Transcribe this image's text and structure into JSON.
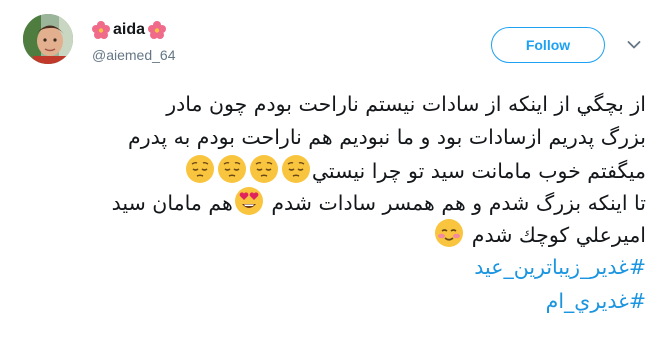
{
  "user": {
    "display_name": "aida",
    "handle": "@aiemed_64",
    "avatar": "avatar-photo",
    "name_emoji": "hibiscus-icon"
  },
  "actions": {
    "follow_label": "Follow",
    "caret_icon": "chevron-down-icon"
  },
  "colors": {
    "accent": "#1da1f2",
    "hashtag": "#1b95e0",
    "text": "#14171a",
    "muted": "#657786"
  },
  "tweet": {
    "line1": "از بچگي از اينكه از سادات نيستم ناراحت بودم چون مادر",
    "line2": "بزرگ پدريم ازسادات بود و ما نبوديم هم ناراحت بودم به پدرم",
    "line3": "ميگفتم  خوب مامانت سيد تو چرا نيستي",
    "line3_emoji": "pensive-face-icon",
    "line4a": "تا اينكه بزرگ شدم و هم همسر سادات شدم",
    "line4b": "هم مامان سيد",
    "line4_emoji": "heart-eyes-face-icon",
    "line5": "اميرعلي كوچك شدم",
    "line5_emoji": "relieved-face-icon",
    "hashtags": [
      "#غدير_زيباترين_عيد",
      "#غديري_ام"
    ]
  }
}
